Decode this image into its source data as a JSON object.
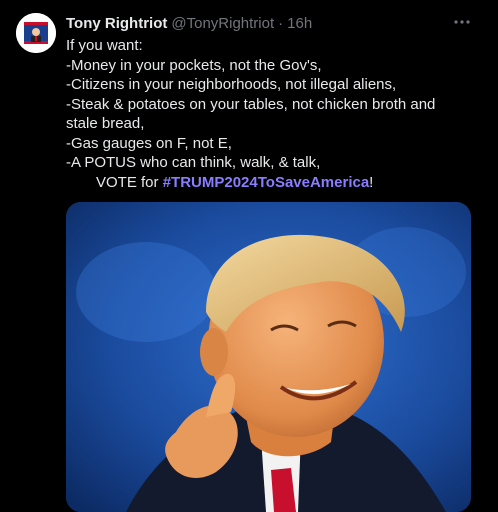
{
  "tweet": {
    "display_name": "Tony Rightriot",
    "handle": "@TonyRightriot",
    "separator": "·",
    "time": "16h",
    "more_icon": "more-horizontal-icon",
    "lines": [
      "If you want:",
      "-Money in your pockets, not the Gov's,",
      "-Citizens in your neighborhoods, not illegal aliens,",
      "-Steak & potatoes on your tables, not chicken broth and",
      "stale bread,",
      "-Gas gauges on F, not E,",
      "-A POTUS who can think, walk, & talk,"
    ],
    "vote_prefix": "VOTE for ",
    "hashtag": "#TRUMP2024ToSaveAmerica",
    "vote_suffix": "!"
  },
  "colors": {
    "background": "#000000",
    "text": "#e7e9ea",
    "secondary": "#71767b",
    "hashtag": "#8a7dff"
  }
}
